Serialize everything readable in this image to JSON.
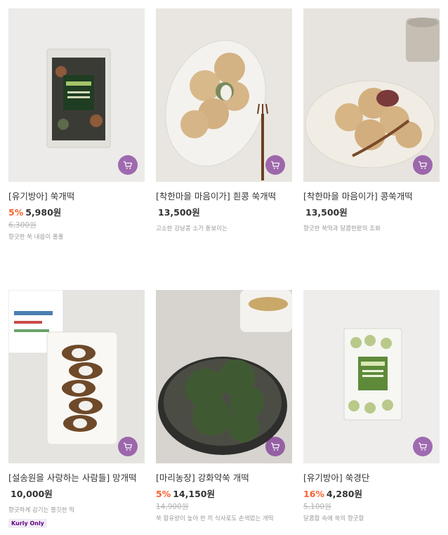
{
  "products": [
    {
      "name": "[유기방아] 쑥개떡",
      "discount": "5%",
      "price": "5,980원",
      "original_price": "6,300원",
      "description": "향긋한 쑥 내음이 폴폴",
      "badge": ""
    },
    {
      "name": "[착한마을 마음이가] 흰콩 쑥개떡",
      "discount": "",
      "price": "13,500원",
      "original_price": "",
      "description": "고소한 강낭콩 소가 돋보이는",
      "badge": ""
    },
    {
      "name": "[착한마을 마음이가] 콩쑥개떡",
      "discount": "",
      "price": "13,500원",
      "original_price": "",
      "description": "향긋한 쑥떡과 달콤한팥의 조화",
      "badge": ""
    },
    {
      "name": "[설송원을 사랑하는 사람들] 망개떡",
      "discount": "",
      "price": "10,000원",
      "original_price": "",
      "description": "향긋하게 감기는 쫄깃한 떡",
      "badge": "Kurly Only"
    },
    {
      "name": "[마리농장] 강화약쑥 개떡",
      "discount": "5%",
      "price": "14,150원",
      "original_price": "14,900원",
      "description": "쑥 함유량이 높아 한 끼 식사로도 손색없는 개떡",
      "badge": ""
    },
    {
      "name": "[유기방아] 쑥경단",
      "discount": "16%",
      "price": "4,280원",
      "original_price": "5,100원",
      "description": "달콤함 속에 쑥의 향긋함",
      "badge": ""
    }
  ],
  "icons": {
    "cart": "cart-icon"
  },
  "colors": {
    "discount": "#fa622f",
    "cart_button": "#5f0080",
    "badge_text": "#5f0080"
  }
}
